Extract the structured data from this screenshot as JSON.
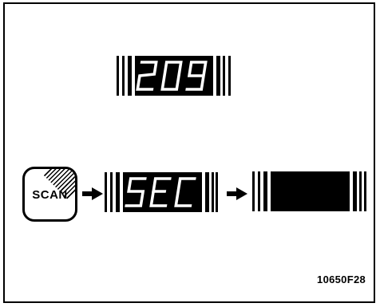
{
  "display_top": {
    "digits": [
      "2",
      "0",
      "9"
    ]
  },
  "scan_button": {
    "label": "SCAN"
  },
  "display_mid": {
    "digits": [
      "S",
      "E",
      "C"
    ]
  },
  "display_right": {
    "digits": []
  },
  "figure_code": "10650F28",
  "colors": {
    "ink": "#000000",
    "segment": "#ffffff",
    "background": "#ffffff"
  }
}
